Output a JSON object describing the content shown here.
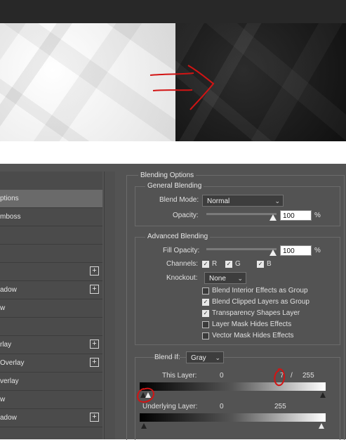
{
  "styles_list": {
    "items": [
      {
        "label": "ptions",
        "active": true,
        "plus": false
      },
      {
        "label": "mboss",
        "active": false,
        "plus": false
      },
      {
        "label": "",
        "active": false,
        "plus": false
      },
      {
        "label": "",
        "active": false,
        "plus": false
      },
      {
        "label": "",
        "active": false,
        "plus": true
      },
      {
        "label": "adow",
        "active": false,
        "plus": true
      },
      {
        "label": "w",
        "active": false,
        "plus": false
      },
      {
        "label": "",
        "active": false,
        "plus": false
      },
      {
        "label": "rlay",
        "active": false,
        "plus": true
      },
      {
        "label": "Overlay",
        "active": false,
        "plus": true
      },
      {
        "label": "verlay",
        "active": false,
        "plus": false
      },
      {
        "label": "w",
        "active": false,
        "plus": false
      },
      {
        "label": "adow",
        "active": false,
        "plus": true
      }
    ],
    "plus_glyph": "+"
  },
  "blending": {
    "title": "Blending Options",
    "general": {
      "title": "General Blending",
      "blend_mode_label": "Blend Mode:",
      "blend_mode_value": "Normal",
      "opacity_label": "Opacity:",
      "opacity_value": "100",
      "opacity_unit": "%"
    },
    "advanced": {
      "title": "Advanced Blending",
      "fill_opacity_label": "Fill Opacity:",
      "fill_opacity_value": "100",
      "fill_opacity_unit": "%",
      "channels_label": "Channels:",
      "channels": [
        {
          "label": "R",
          "checked": true
        },
        {
          "label": "G",
          "checked": true
        },
        {
          "label": "B",
          "checked": true
        }
      ],
      "knockout_label": "Knockout:",
      "knockout_value": "None",
      "options": [
        {
          "label": "Blend Interior Effects as Group",
          "checked": false
        },
        {
          "label": "Blend Clipped Layers as Group",
          "checked": true
        },
        {
          "label": "Transparency Shapes Layer",
          "checked": true
        },
        {
          "label": "Layer Mask Hides Effects",
          "checked": false
        },
        {
          "label": "Vector Mask Hides Effects",
          "checked": false
        }
      ]
    },
    "blend_if": {
      "label": "Blend If:",
      "value": "Gray",
      "this_layer_label": "This Layer:",
      "this_layer_low": "0",
      "this_layer_mid": "7",
      "this_layer_sep": "/",
      "this_layer_high": "255",
      "underlying_label": "Underlying Layer:",
      "underlying_low": "0",
      "underlying_high": "255"
    }
  },
  "icons": {
    "chevron": "chevron-down-icon",
    "check": "check-icon"
  }
}
